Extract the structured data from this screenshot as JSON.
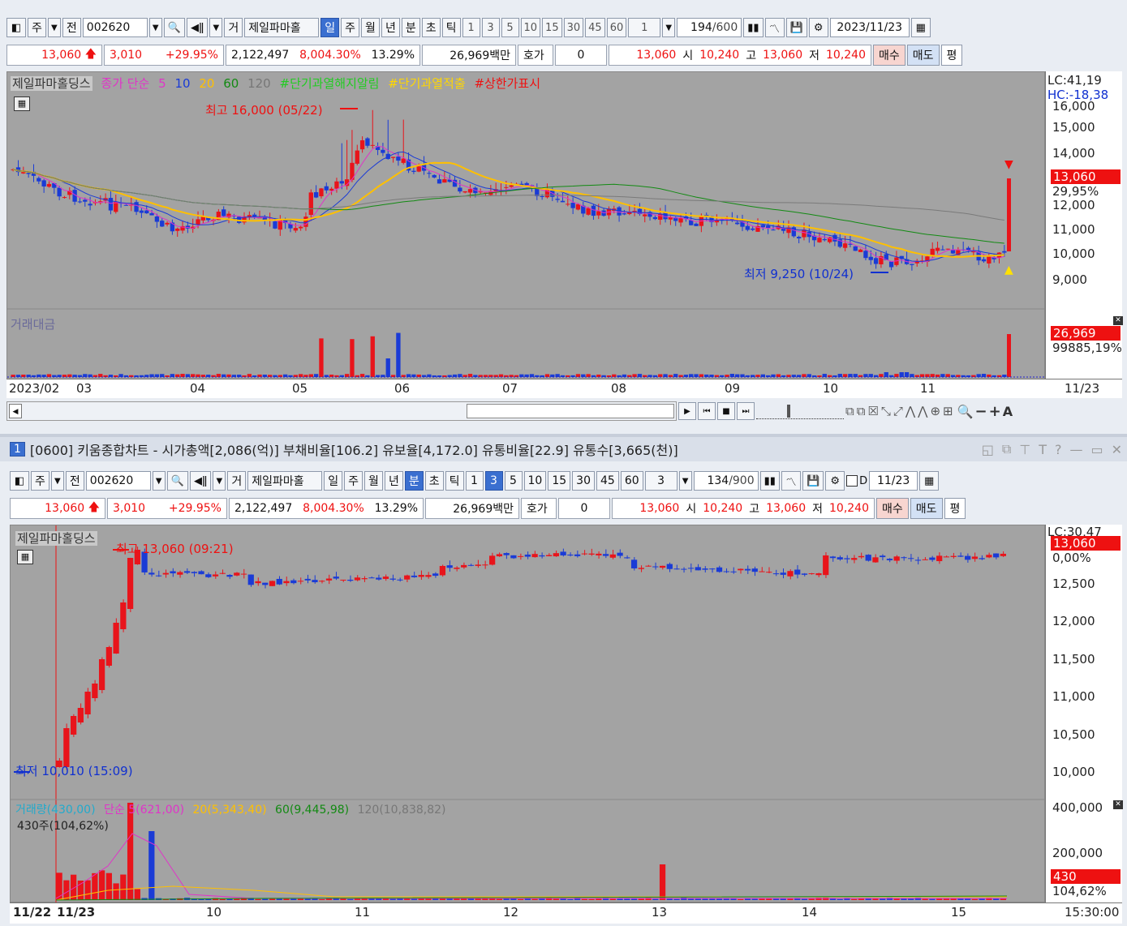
{
  "top": {
    "toolbar": {
      "btn_ju": "주",
      "btn_jeon": "전",
      "code": "002620",
      "btn_geo": "거",
      "name": "제일파마홀",
      "periods": [
        "일",
        "주",
        "월",
        "년",
        "분",
        "초",
        "틱"
      ],
      "selected_period": "일",
      "nums": [
        "1",
        "3",
        "5",
        "10",
        "15",
        "30",
        "45",
        "60"
      ],
      "unit": "1",
      "count": "194",
      "count_max": "/600",
      "date": "2023/11/23"
    },
    "quote": {
      "price": "13,060",
      "change": "3,010",
      "pct": "+29.95%",
      "volume": "2,122,497",
      "vol_pct": "8,004.30%",
      "turnover": "13.29%",
      "amount": "26,969백만",
      "hoga_label": "호가",
      "hoga_value": "0",
      "cur": "13,060",
      "open_label": "시",
      "open": "10,240",
      "high_label": "고",
      "high": "13,060",
      "low_label": "저",
      "low": "10,240",
      "buy": "매수",
      "sell": "매도",
      "flat": "평"
    },
    "legend": {
      "name": "제일파마홀딩스",
      "close_simple": "종가 단순",
      "ma5": "5",
      "ma10": "10",
      "ma20": "20",
      "ma60": "60",
      "ma120": "120",
      "sig1": "#단기과열해지알림",
      "sig2": "#단기과열적출",
      "sig3": "#상한가표시"
    },
    "annot_high": "최고 16,000 (05/22)",
    "annot_low": "최저 9,250 (10/24)",
    "lc": "LC:41,19",
    "hc": "HC:-18,38",
    "price_badge": "13,060",
    "pct_badge": "29,95%",
    "yticks": [
      "16,000",
      "15,000",
      "14,000",
      "12,000",
      "11,000",
      "10,000",
      "9,000"
    ],
    "vol_title": "거래대금",
    "vol_badge": "26,969",
    "vol_badge2": "99885,19%",
    "dates": [
      "2023/02",
      "03",
      "04",
      "05",
      "06",
      "07",
      "08",
      "09",
      "10",
      "11"
    ],
    "last_date": "11/23",
    "color_up": "#e8141b",
    "color_down": "#1a3bd6"
  },
  "bottom": {
    "title": "[0600] 키움종합차트 - 시가총액[2,086(억)] 부채비율[106.2] 유보율[4,172.0] 유통비율[22.9] 유통수[3,665(천)]",
    "title_num": "1",
    "toolbar": {
      "btn_ju": "주",
      "btn_jeon": "전",
      "code": "002620",
      "btn_geo": "거",
      "name": "제일파마홀",
      "periods": [
        "일",
        "주",
        "월",
        "년",
        "분",
        "초",
        "틱"
      ],
      "selected_period": "분",
      "nums": [
        "1",
        "3",
        "5",
        "10",
        "15",
        "30",
        "45",
        "60"
      ],
      "selected_num": "3",
      "unit": "3",
      "count": "134",
      "count_max": "/900",
      "d_label": "D",
      "date": "11/23"
    },
    "legend_name": "제일파마홀딩스",
    "annot_high": "최고 13,060 (09:21)",
    "annot_low": "최저 10,010 (15:09)",
    "lc": "LC:30,47",
    "price_badge": "13,060",
    "pct_badge": "0,00%",
    "yticks": [
      "12,500",
      "12,000",
      "11,500",
      "11,000",
      "10,500",
      "10,000"
    ],
    "vol_legend": {
      "vol": "거래량(430,00)",
      "ma5": "단순 5(621,00)",
      "ma20": "20(5,343,40)",
      "ma60": "60(9,445,98)",
      "ma120": "120(10,838,82)"
    },
    "vol_sub": "430주(104,62%)",
    "vol_yticks": [
      "400,000",
      "200,000"
    ],
    "vol_badge": "430",
    "vol_badge2": "104,62%",
    "times": [
      "11/22",
      "11/23",
      "10",
      "11",
      "12",
      "13",
      "14",
      "15"
    ],
    "last_time": "15:30:00"
  }
}
